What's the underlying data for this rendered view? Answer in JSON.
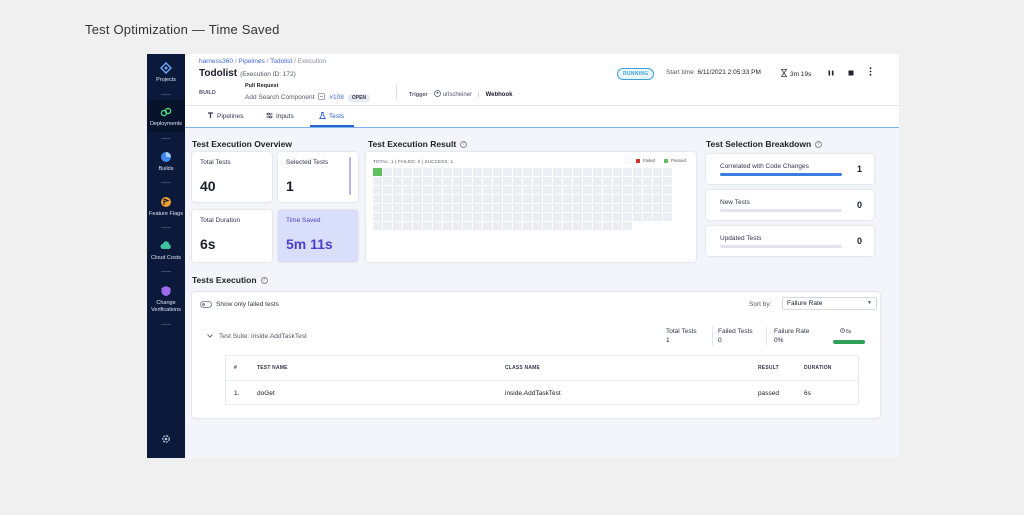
{
  "slide": {
    "title": "Test Optimization — Time Saved"
  },
  "sidebar": {
    "items": [
      {
        "label": "Projects",
        "icon": "projects-icon"
      },
      {
        "label": "Deployments",
        "icon": "deployments-icon"
      },
      {
        "label": "Builds",
        "icon": "builds-icon"
      },
      {
        "label": "Feature Flags",
        "icon": "feature-flags-icon"
      },
      {
        "label": "Cloud Costs",
        "icon": "cloud-costs-icon"
      },
      {
        "label": "Change Verifications",
        "label_line1": "Change",
        "label_line2": "Verifications",
        "icon": "change-verifications-icon"
      }
    ],
    "settings_icon": "gear-icon"
  },
  "header": {
    "breadcrumb": {
      "account": "harness360",
      "sep": "/",
      "pipelines": "Pipelines",
      "pipeline": "Todolist",
      "current": "Execution"
    },
    "title": "Todolist",
    "execution_id": "(Execution ID: 172)",
    "build_label": "BUILD",
    "pr_label": "Pull Request",
    "pr_title": "Add Search Component",
    "pr_number": "#108",
    "pr_status": "OPEN",
    "trigger_label": "Trigger",
    "trigger_user": "urlscheiner",
    "trigger_sep": "|",
    "trigger_type": "Webhook",
    "status": "RUNNING",
    "start_time_label": "Start time",
    "start_time": "6/11/2021 2:05:33 PM",
    "duration": "3m 19s"
  },
  "tabs": [
    {
      "label": "Pipelines",
      "icon": "pipeline-icon"
    },
    {
      "label": "Inputs",
      "icon": "inputs-icon"
    },
    {
      "label": "Tests",
      "icon": "tests-icon",
      "active": true
    }
  ],
  "overview": {
    "title": "Test Execution Overview",
    "total_tests_label": "Total Tests",
    "total_tests": "40",
    "selected_tests_label": "Selected Tests",
    "selected_tests": "1",
    "total_duration_label": "Total Duration",
    "total_duration": "6s",
    "time_saved_label": "Time Saved",
    "time_saved": "5m 11s"
  },
  "result": {
    "title": "Test Execution Result",
    "summary": "TOTAL: 1 | FAILED: 0 | SUCCESS: 1",
    "legend_failed": "Failed",
    "legend_passed": "Passed",
    "colors": {
      "failed": "#d0342c",
      "passed": "#5fc060"
    },
    "grid_passed": 1
  },
  "breakdown": {
    "title": "Test Selection Breakdown",
    "items": [
      {
        "label": "Correlated with Code Changes",
        "value": "1",
        "fraction": 1.0
      },
      {
        "label": "New Tests",
        "value": "0",
        "fraction": 0
      },
      {
        "label": "Updated Tests",
        "value": "0",
        "fraction": 0
      }
    ]
  },
  "execution": {
    "title": "Tests Execution",
    "toggle_label": "Show only failed tests",
    "sort_label": "Sort by:",
    "sort_value": "Failure Rate",
    "suite": {
      "name": "Test Suite: inside.AddTaskTest",
      "total_tests_label": "Total Tests",
      "total_tests": "1",
      "failed_tests_label": "Failed Tests",
      "failed_tests": "0",
      "failure_rate_label": "Failure Rate",
      "failure_rate": "0%",
      "duration": "6s"
    },
    "table": {
      "headers": [
        "#",
        "TEST NAME",
        "CLASS NAME",
        "RESULT",
        "DURATION"
      ],
      "rows": [
        {
          "index": "1.",
          "name": "doGet",
          "class": "inside.AddTaskTest",
          "result": "passed",
          "duration": "6s"
        }
      ]
    }
  }
}
